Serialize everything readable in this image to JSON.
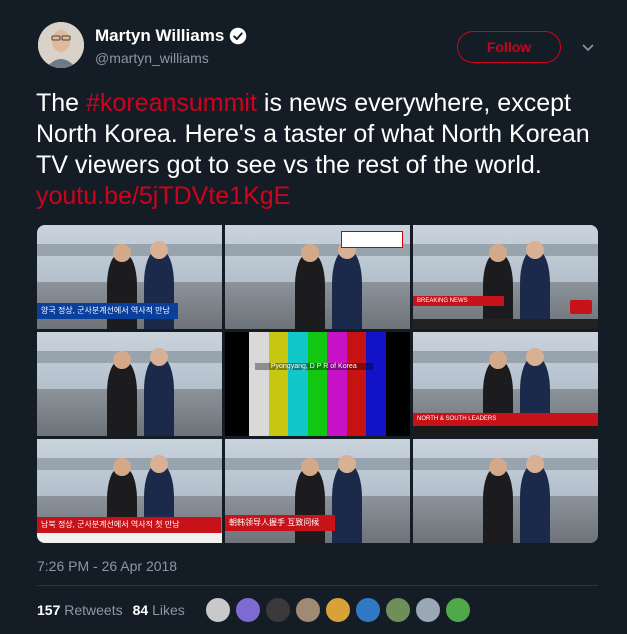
{
  "author": {
    "name": "Martyn Williams",
    "handle": "@martyn_williams",
    "verified": true
  },
  "follow_label": "Follow",
  "tweet": {
    "text_before": "The ",
    "hashtag": "#koreansummit",
    "text_after": " is news everywhere, except North Korea. Here's a taster of what North Korean TV viewers got to see vs the rest of the world. ",
    "link": "youtu.be/5jTDVte1KgE"
  },
  "media": {
    "tiles": [
      {
        "caption": "양국 정상, 군사분계선에서 역사적 만남",
        "style": "blue"
      },
      {
        "caption": "",
        "style": "plain"
      },
      {
        "caption": "BREAKING NEWS",
        "style": "red"
      },
      {
        "caption": "",
        "style": "plain"
      },
      {
        "caption": "Pyongyang, D P R of Korea",
        "style": "testcard"
      },
      {
        "caption": "NORTH & SOUTH LEADERS",
        "style": "red"
      },
      {
        "caption": "남북 정상, 군사분계선에서 역사적 첫 만남",
        "style": "red"
      },
      {
        "caption": "朝韩领导人握手 互致问候",
        "style": "red"
      },
      {
        "caption": "",
        "style": "plain"
      }
    ]
  },
  "timestamp": "7:26 PM - 26 Apr 2018",
  "stats": {
    "retweets_count": "157",
    "retweets_label": "Retweets",
    "likes_count": "84",
    "likes_label": "Likes"
  },
  "colors": {
    "background": "#141d26",
    "accent": "#d0021b",
    "secondary_text": "#8899a6"
  }
}
